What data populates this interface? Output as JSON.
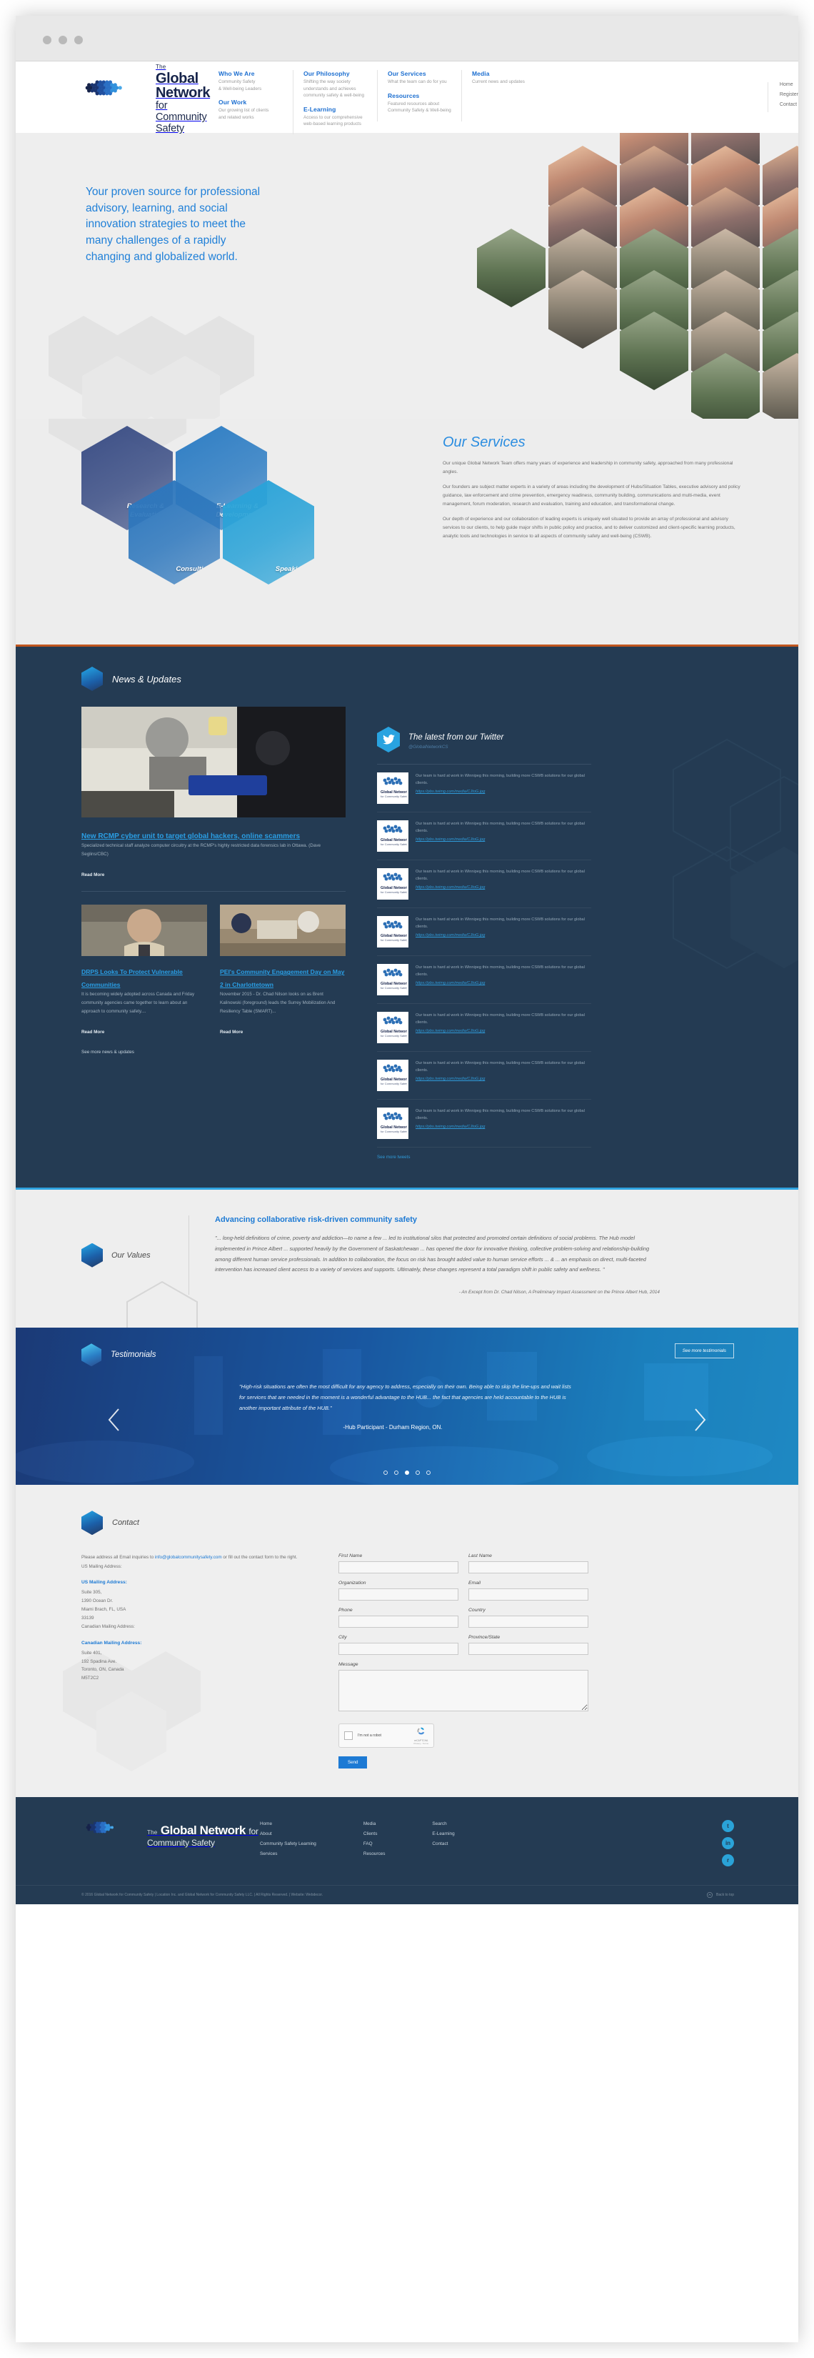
{
  "brand": {
    "the": "The",
    "name": "Global Network",
    "tagline": "for Community Safety",
    "accent": "#1d7ad4",
    "dark": "#243b53"
  },
  "nav": {
    "groups": [
      {
        "items": [
          {
            "title": "Who We Are",
            "desc": "Community Safety\n& Well-being Leaders"
          },
          {
            "title": "Our Work",
            "desc": "Our growing list of clients\nand related works"
          }
        ]
      },
      {
        "items": [
          {
            "title": "Our Philosophy",
            "desc": "Shifting the way society\nunderstands and achieves\ncommunity safety & well-being"
          },
          {
            "title": "E-Learning",
            "desc": "Access to our comprehensive\nweb-based learning products"
          }
        ]
      },
      {
        "items": [
          {
            "title": "Our Services",
            "desc": "What the team can do for you"
          },
          {
            "title": "Resources",
            "desc": "Featured resources about\nCommunity Safety & Well-being"
          }
        ]
      },
      {
        "items": [
          {
            "title": "Media",
            "desc": "Current news and updates"
          }
        ]
      }
    ],
    "simple": [
      "Home",
      "Register",
      "Contact"
    ]
  },
  "hero": {
    "headline": "Your proven source for professional advisory, learning, and social innovation strategies to meet the many challenges of a rapidly changing and globalized world."
  },
  "services": {
    "title": "Our Services",
    "paragraphs": [
      "Our unique Global Network Team offers many years of experience and leadership in community safety, approached from many professional angles.",
      "Our founders are subject matter experts in a variety of areas including the development of Hubs/Situation Tables, executive advisory and policy guidance, law enforcement and crime prevention, emergency readiness, community building, communications and multi-media, event management, forum moderation, research and evaluation, training and education, and transformational change.",
      "Our depth of experience and our collaboration of leading experts is uniquely well situated to provide an array of professional and advisory services to our clients, to help guide major shifts in public policy and practice, and to deliver customized and client-specific learning products, analytic tools and technologies in service to all aspects of community safety and well-being (CSWB)."
    ],
    "tiles": [
      {
        "label": "Research &\nEvaluation",
        "color": "#3c4f86"
      },
      {
        "label": "E-Learning &\nDevelopment",
        "color": "#2f7ec4"
      },
      {
        "label": "Consulting",
        "color": "#2d77bd"
      },
      {
        "label": "Speaking",
        "color": "#2aa3d8"
      }
    ]
  },
  "news": {
    "section_title": "News & Updates",
    "feature": {
      "headline": "New RCMP cyber unit to target global hackers, online scammers",
      "excerpt": "Specialized technical staff analyze computer circuitry at the RCMP's highly restricted data forensics lab in Ottawa. (Dave Seglins/CBC)",
      "read_more": "Read More"
    },
    "items": [
      {
        "headline": "DRPS Looks To Protect Vulnerable Communities",
        "excerpt": "It is becoming widely adopted across Canada and Friday community agencies came together to learn about an approach to community safety....",
        "read_more": "Read More"
      },
      {
        "headline": "PEI's Community Engagement Day on May 2 in Charlottetown",
        "excerpt": "November 2015 - Dr. Chad Nilson looks on as Brent Kalinowski (foreground) leads the Surrey Mobilization And Resiliency Table (SMART)...",
        "read_more": "Read More"
      }
    ],
    "see_more": "See more news & updates"
  },
  "twitter": {
    "title": "The latest from our Twitter",
    "handle": "@GlobalNetworkCS",
    "follow": "See more tweets",
    "tweets": [
      {
        "text": "Our team is hard at work in Winnipeg this morning, building more CSWB solutions for our global clients.",
        "link": "https://pbs.twimg.com/media/CJtoG.jpg"
      },
      {
        "text": "Our team is hard at work in Winnipeg this morning, building more CSWB solutions for our global clients.",
        "link": "https://pbs.twimg.com/media/CJtoG.jpg"
      },
      {
        "text": "Our team is hard at work in Winnipeg this morning, building more CSWB solutions for our global clients.",
        "link": "https://pbs.twimg.com/media/CJtoG.jpg"
      },
      {
        "text": "Our team is hard at work in Winnipeg this morning, building more CSWB solutions for our global clients.",
        "link": "https://pbs.twimg.com/media/CJtoG.jpg"
      },
      {
        "text": "Our team is hard at work in Winnipeg this morning, building more CSWB solutions for our global clients.",
        "link": "https://pbs.twimg.com/media/CJtoG.jpg"
      },
      {
        "text": "Our team is hard at work in Winnipeg this morning, building more CSWB solutions for our global clients.",
        "link": "https://pbs.twimg.com/media/CJtoG.jpg"
      },
      {
        "text": "Our team is hard at work in Winnipeg this morning, building more CSWB solutions for our global clients.",
        "link": "https://pbs.twimg.com/media/CJtoG.jpg"
      },
      {
        "text": "Our team is hard at work in Winnipeg this morning, building more CSWB solutions for our global clients.",
        "link": "https://pbs.twimg.com/media/CJtoG.jpg"
      }
    ]
  },
  "values": {
    "label": "Our Values",
    "heading": "Advancing collaborative risk-driven community safety",
    "quote": "\"... long-held definitions of crime, poverty and addiction—to name a few ... led to institutional silos that protected and promoted certain definitions of social problems. The Hub model implemented in Prince Albert ... supported heavily by the Government of Saskatchewan ... has opened the door for innovative thinking, collective problem-solving and relationship-building among different human service professionals. In addition to collaboration, the focus on risk has brought added value to human service efforts ... & ... an emphasis on direct, multi-faceted intervention has increased client access to a variety of services and supports. Ultimately, these changes represent a total paradigm shift in public safety and wellness. \"",
    "attribution": "- An Except from Dr. Chad Nilson, A Preliminary Impact Assessment on the Prince Albert Hub, 2014"
  },
  "testimonials": {
    "label": "Testimonials",
    "button": "See more testimonials",
    "quote": "\"High-risk situations are often the most difficult for any agency to address, especially on their own. Being able to skip the line-ups and wait lists for services that are needed in the moment is a wonderful advantage to the HUB... the fact that agencies are held accountable to the HUB is another important attribute of the HUB.\"",
    "attribution": "-Hub Participant - Durham Region, ON.",
    "slide_count": 5,
    "active_slide": 2
  },
  "contact": {
    "label": "Contact",
    "note_prefix": "Please address all Email inquiries to ",
    "email": "info@globalcommunitysafety.com",
    "note_suffix": " or fill out the contact form to the right.",
    "note_line3": "US Mailing Address:",
    "us_heading": "US Mailing Address:",
    "us_address": "Suite 305,\n1390 Ocean Dr.\nMiami Brach, FL, USA\n33139\nCanadian Mailing Address:",
    "ca_heading": "Canadian Mailing Address:",
    "ca_address": "Suite 401,\n192 Spadina Ave.\nToronto, ON, Canada\nM5T2C2",
    "form": {
      "first_name": "First Name",
      "last_name": "Last Name",
      "organization": "Organization",
      "email": "Email",
      "phone": "Phone",
      "country": "Country",
      "city": "City",
      "province": "Province/State",
      "message": "Message",
      "recaptcha_label": "I'm not a robot",
      "recaptcha_brand": "reCAPTCHA",
      "recaptcha_legal": "Privacy - Terms",
      "submit": "Send"
    }
  },
  "footer": {
    "col1": [
      "Home",
      "About",
      "Community Safety Learning",
      "Services"
    ],
    "col2": [
      "Media",
      "Clients",
      "FAQ",
      "Resources"
    ],
    "col3": [
      "Search",
      "E-Learning",
      "Contact"
    ],
    "social": [
      {
        "name": "twitter-icon",
        "glyph": "t",
        "color": "#2aa3d8"
      },
      {
        "name": "linkedin-icon",
        "glyph": "in",
        "color": "#2aa3d8"
      },
      {
        "name": "rss-icon",
        "glyph": "r",
        "color": "#2aa3d8"
      }
    ],
    "copyright": "© 2016 Global Network for Community Safety | Location Inc. and Global Network for Community Safety LLC.  |  All Rights Reserved.  |  Website: Webdecor.",
    "credit": "Back to top"
  }
}
